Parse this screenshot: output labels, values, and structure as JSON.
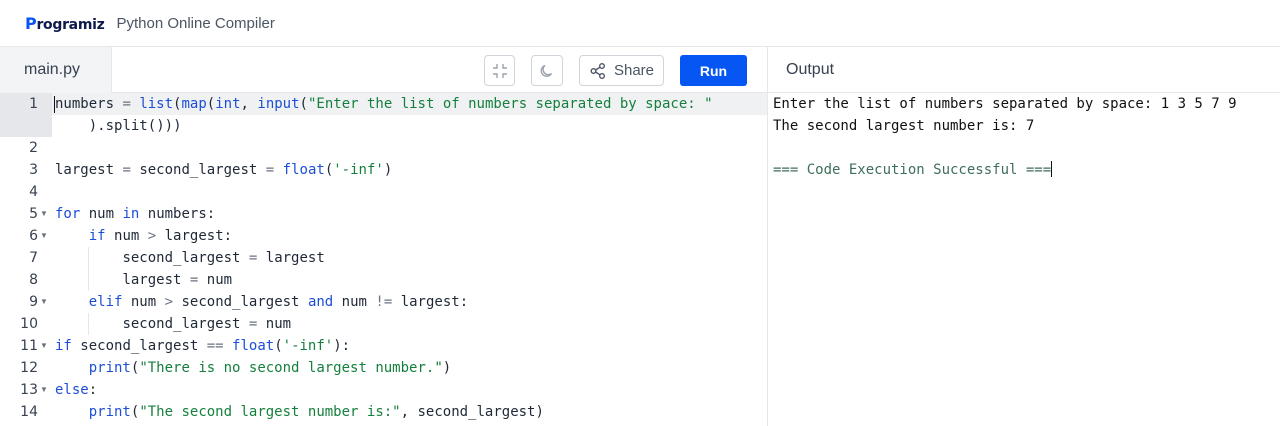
{
  "brand": {
    "name": "Programiz",
    "mark": "P",
    "rest": "rogramiz"
  },
  "app_title": "Python Online Compiler",
  "editor": {
    "tab_label": "main.py",
    "share_label": "Share",
    "run_label": "Run"
  },
  "output": {
    "header": "Output",
    "lines": [
      "Enter the list of numbers separated by space: 1 3 5 7 9",
      "The second largest number is: 7",
      "",
      "=== Code Execution Successful ==="
    ]
  },
  "code": {
    "line_numbers": [
      "1",
      "2",
      "3",
      "4",
      "5",
      "6",
      "7",
      "8",
      "9",
      "10",
      "11",
      "12",
      "13",
      "14"
    ],
    "fold_lines": [
      "5",
      "6",
      "9",
      "11",
      "13"
    ],
    "lines": [
      "numbers = list(map(int, input(\"Enter the list of numbers separated by space: \"",
      "    ).split()))",
      "",
      "largest = second_largest = float('-inf')",
      "",
      "for num in numbers:",
      "    if num > largest:",
      "        second_largest = largest",
      "        largest = num",
      "    elif num > second_largest and num != largest:",
      "        second_largest = num",
      "if second_largest == float('-inf'):",
      "    print(\"There is no second largest number.\")",
      "else:",
      "    print(\"The second largest number is:\", second_largest)"
    ]
  },
  "colors": {
    "accent": "#0556f3",
    "keyword": "#1d4ed8",
    "string": "#15803d",
    "success": "#3f6e5a"
  },
  "icons": [
    "fullscreen-exit-icon",
    "moon-icon",
    "share-icon"
  ]
}
